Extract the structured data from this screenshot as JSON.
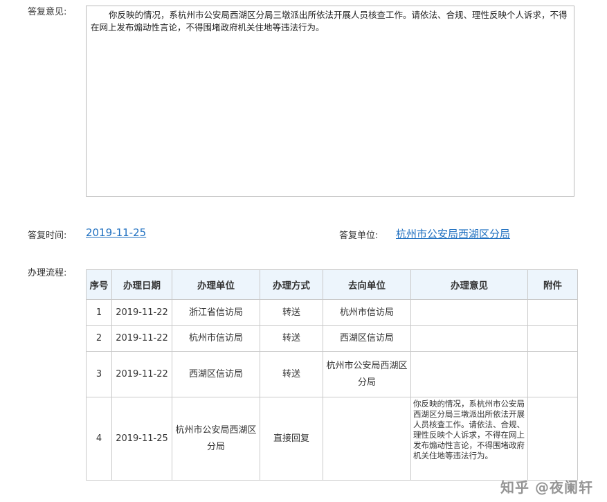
{
  "reply": {
    "label": "答复意见:",
    "text": "你反映的情况，系杭州市公安局西湖区分局三墩派出所依法开展人员核查工作。请依法、合规、理性反映个人诉求，不得在网上发布煽动性言论，不得围堵政府机关住地等违法行为。"
  },
  "meta": {
    "time_label": "答复时间:",
    "time_value": "2019-11-25",
    "unit_label": "答复单位:",
    "unit_value": "杭州市公安局西湖区分局"
  },
  "flow": {
    "label": "办理流程:",
    "headers": [
      "序号",
      "办理日期",
      "办理单位",
      "办理方式",
      "去向单位",
      "办理意见",
      "附件"
    ],
    "rows": [
      {
        "no": "1",
        "date": "2019-11-22",
        "unit": "浙江省信访局",
        "method": "转送",
        "dest": "杭州市信访局",
        "opinion": "",
        "attachment": ""
      },
      {
        "no": "2",
        "date": "2019-11-22",
        "unit": "杭州市信访局",
        "method": "转送",
        "dest": "西湖区信访局",
        "opinion": "",
        "attachment": ""
      },
      {
        "no": "3",
        "date": "2019-11-22",
        "unit": "西湖区信访局",
        "method": "转送",
        "dest": "杭州市公安局西湖区分局",
        "opinion": "",
        "attachment": ""
      },
      {
        "no": "4",
        "date": "2019-11-25",
        "unit": "杭州市公安局西湖区分局",
        "method": "直接回复",
        "dest": "",
        "opinion": "你反映的情况，系杭州市公安局西湖区分局三墩派出所依法开展人员核查工作。请依法、合规、理性反映个人诉求，不得在网上发布煽动性言论，不得围堵政府机关住地等违法行为。",
        "attachment": ""
      }
    ]
  },
  "watermark": "知乎 @夜阑轩",
  "colors": {
    "link": "#1e6fc0",
    "method": "#e5a021",
    "header_bg": "#edf5fc"
  }
}
